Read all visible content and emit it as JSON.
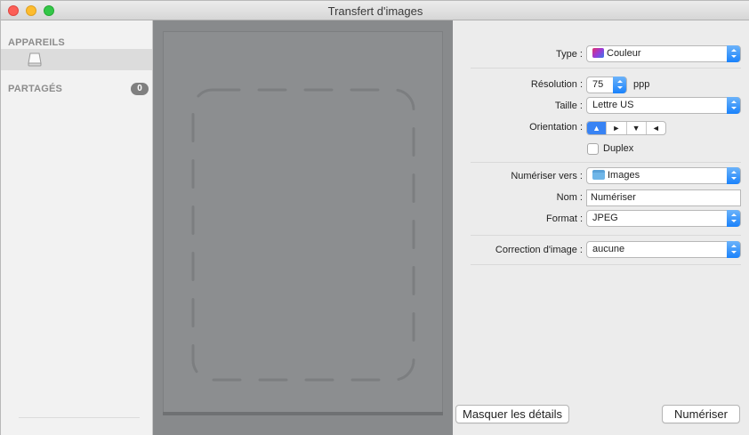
{
  "window": {
    "title": "Transfert d'images"
  },
  "sidebar": {
    "devices_header": "APPAREILS",
    "shared_header": "PARTAGÉS",
    "shared_count": "0"
  },
  "settings": {
    "type_label": "Type :",
    "type_value": "Couleur",
    "resolution_label": "Résolution :",
    "resolution_value": "75",
    "resolution_unit": "ppp",
    "size_label": "Taille :",
    "size_value": "Lettre US",
    "orientation_label": "Orientation :",
    "duplex_label": "Duplex",
    "scan_to_label": "Numériser vers :",
    "scan_to_value": "Images",
    "name_label": "Nom :",
    "name_value": "Numériser",
    "format_label": "Format :",
    "format_value": "JPEG",
    "correction_label": "Correction d'image :",
    "correction_value": "aucune"
  },
  "buttons": {
    "hide_details": "Masquer les détails",
    "scan": "Numériser"
  },
  "icons": {
    "orientation_options": [
      "portrait-upright-icon",
      "landscape-right-icon",
      "portrait-inverted-icon",
      "landscape-left-icon"
    ],
    "device": "scanner-drive-icon"
  },
  "colors": {
    "accent": "#1a82fb",
    "preview_background": "#888a8c",
    "close": "#fc5f57",
    "minimize": "#fdbc2e",
    "zoom": "#33c748"
  }
}
